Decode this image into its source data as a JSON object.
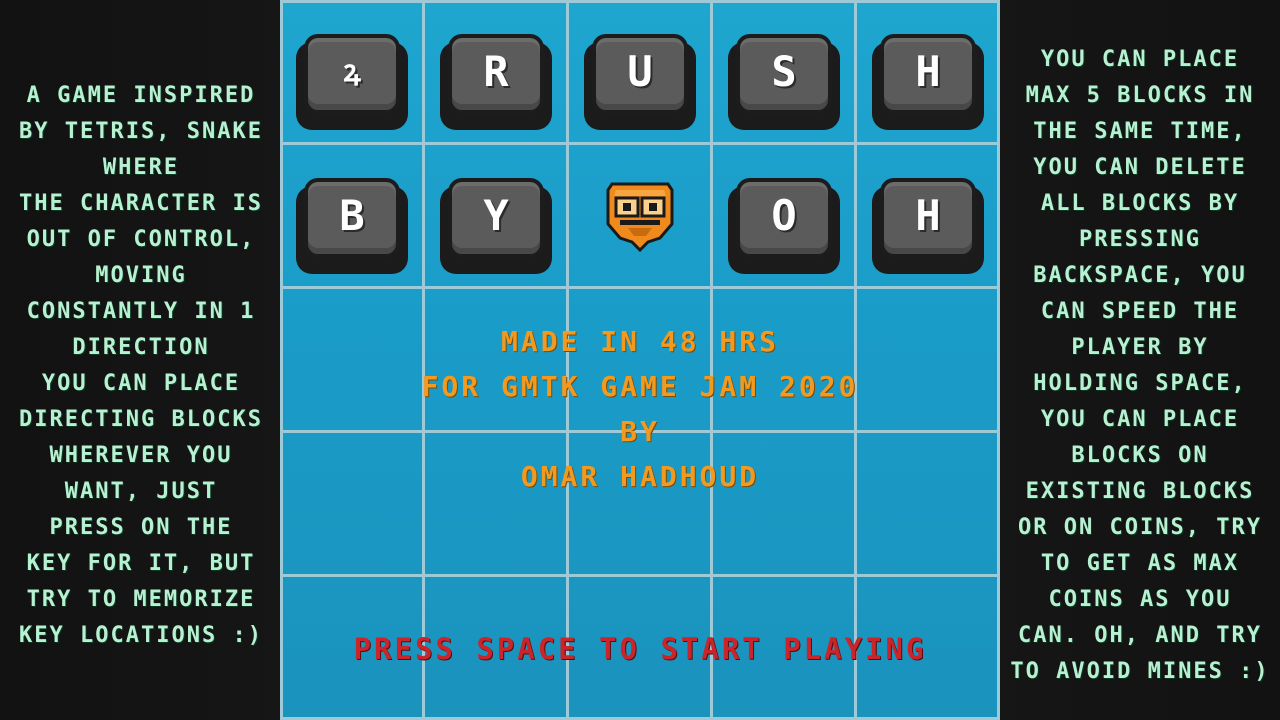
{
  "left_panel": {
    "lines": [
      "A GAME INSPIRED",
      "BY TETRIS, SNAKE",
      "WHERE",
      "THE CHARACTER IS",
      "OUT OF CONTROL,",
      "MOVING",
      "CONSTANTLY IN 1",
      "DIRECTION",
      "YOU CAN PLACE",
      "DIRECTING BLOCKS",
      "WHEREVER YOU",
      "WANT, JUST",
      "PRESS ON THE",
      "KEY FOR IT, BUT",
      "TRY TO MEMORIZE",
      "KEY LOCATIONS :)"
    ]
  },
  "right_panel": {
    "lines": [
      "YOU CAN PLACE",
      "MAX 5 BLOCKS IN",
      "THE SAME TIME,",
      "YOU CAN DELETE",
      "ALL BLOCKS BY",
      "PRESSING",
      "BACKSPACE, YOU",
      "CAN SPEED THE",
      "PLAYER BY",
      "HOLDING SPACE,",
      "YOU CAN PLACE",
      "BLOCKS ON",
      "EXISTING BLOCKS",
      "OR ON COINS, TRY",
      "TO GET AS MAX",
      "COINS AS YOU",
      "CAN. OH, AND TRY",
      "TO AVOID MINES :)"
    ]
  },
  "title_keys": {
    "row1": [
      "ꝝ",
      "R",
      "U",
      "S",
      "H"
    ],
    "row2": [
      "B",
      "Y",
      "",
      "O",
      "H"
    ]
  },
  "player": {
    "icon": "owl-character-icon",
    "color": "#f08a1c"
  },
  "credits": {
    "line1": "MADE IN 48 HRS",
    "line2": "FOR GMTK GAME JAM 2020",
    "line3": "BY",
    "line4": "OMAR HADHOUD"
  },
  "start_prompt": "PRESS SPACE TO START PLAYING",
  "colors": {
    "board": "#1a9cc8",
    "grid": "#9ec9d7",
    "side_text": "#b8f0d2",
    "credit_text": "#f29a1f",
    "prompt_text": "#c9252a",
    "key_face": "#5b5b5b"
  }
}
